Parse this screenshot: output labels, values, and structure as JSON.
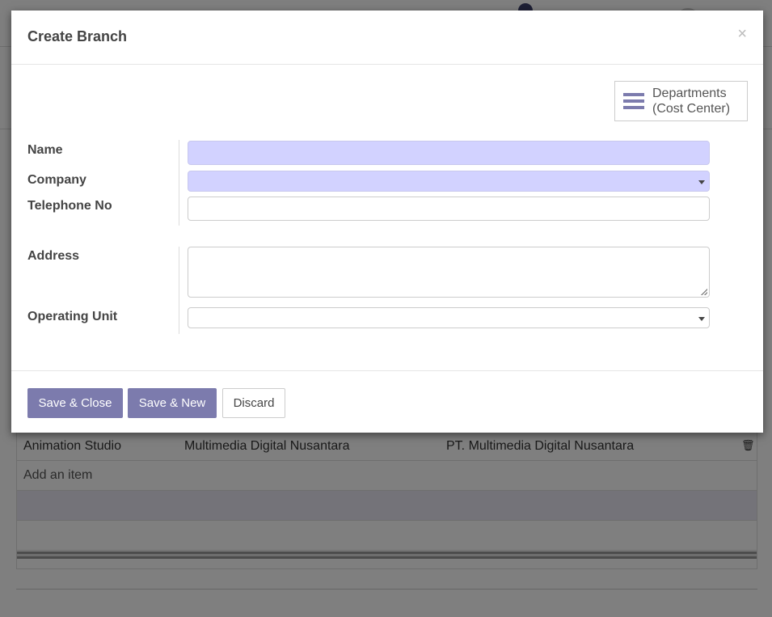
{
  "modal": {
    "title": "Create Branch",
    "close_icon": "×",
    "smart_button": {
      "icon": "bars-icon",
      "line1": "Departments",
      "line2": "(Cost Center)"
    },
    "fields": [
      {
        "label": "Name",
        "value": "",
        "required": true,
        "type": "text"
      },
      {
        "label": "Company",
        "value": "",
        "required": true,
        "type": "select"
      },
      {
        "label": "Telephone No",
        "value": "",
        "type": "text"
      },
      {
        "label": "Address",
        "value": "",
        "type": "textarea"
      },
      {
        "label": "Operating Unit",
        "value": "",
        "type": "select"
      }
    ],
    "buttons": {
      "save_close": "Save & Close",
      "save_new": "Save & New",
      "discard": "Discard"
    }
  },
  "background": {
    "table_rows": [
      {
        "name": "Animation Studio",
        "company": "Multimedia Digital Nusantara",
        "legal": "PT. Multimedia Digital Nusantara"
      }
    ],
    "add_item": "Add an item"
  },
  "colors": {
    "primary": "#7c7bad",
    "required_field": "#d2d2ff"
  }
}
